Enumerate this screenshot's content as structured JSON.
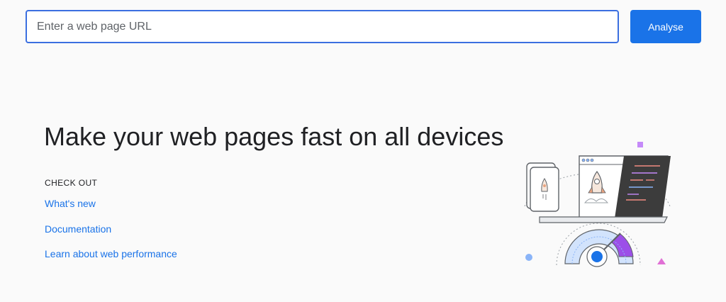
{
  "search": {
    "placeholder": "Enter a web page URL",
    "value": ""
  },
  "analyse_label": "Analyse",
  "hero": {
    "headline": "Make your web pages fast on all devices",
    "check_out_label": "CHECK OUT",
    "links": [
      "What's new",
      "Documentation",
      "Learn about web performance"
    ]
  },
  "colors": {
    "accent": "#1a73e8",
    "headline": "#202124",
    "background": "#fafafa",
    "gauge_purple": "#9c4fe8",
    "code_panel": "#3c3c3c"
  }
}
